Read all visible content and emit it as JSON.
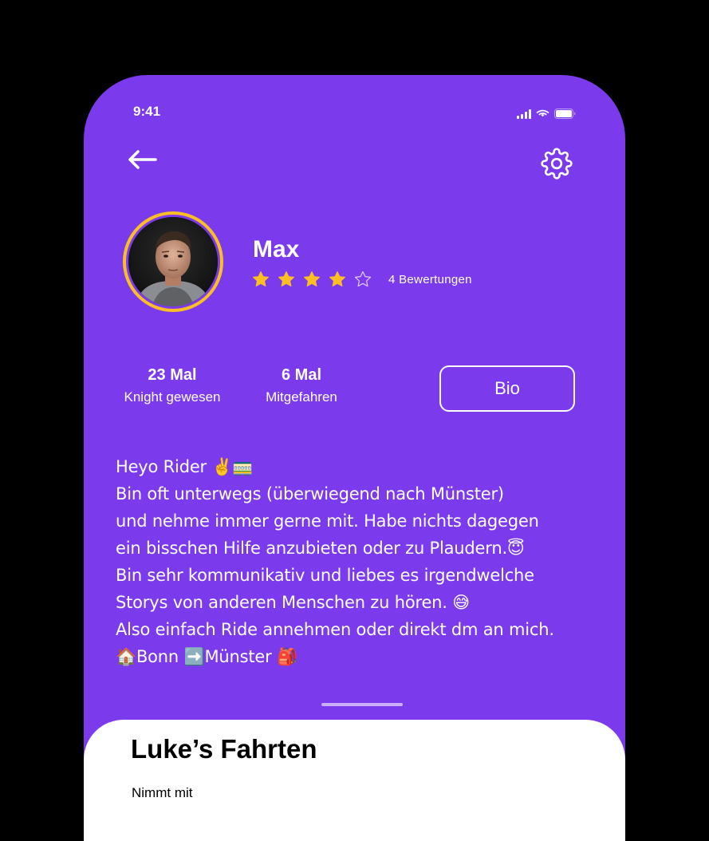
{
  "status_bar": {
    "time": "9:41"
  },
  "header": {
    "back_icon": "arrow-left-icon",
    "settings_icon": "gear-icon"
  },
  "profile": {
    "name": "Max",
    "rating_stars": 4,
    "rating_max": 5,
    "rating_count": "4 Bewertungen",
    "accent_color": "#FBBF24"
  },
  "stats": [
    {
      "value": "23 Mal",
      "label": "Knight gewesen"
    },
    {
      "value": "6 Mal",
      "label": "Mitgefahren"
    }
  ],
  "bio_button": {
    "label": "Bio"
  },
  "bio": {
    "text": "Heyo Rider ✌️🚃\nBin oft unterwegs (überwiegend nach Münster)\nund nehme immer gerne mit. Habe nichts dagegen\nein bisschen Hilfe anzubieten oder zu Plaudern.😇\nBin sehr kommunikativ und liebes es irgendwelche\nStorys von anderen Menschen zu hören. 😅\nAlso einfach Ride annehmen oder direkt dm an mich.\n🏠Bonn ➡️Münster 🎒"
  },
  "sheet": {
    "title": "Luke’s Fahrten",
    "subtitle": "Nimmt mit"
  },
  "colors": {
    "background": "#7C3AED",
    "star": "#FBBF24"
  }
}
